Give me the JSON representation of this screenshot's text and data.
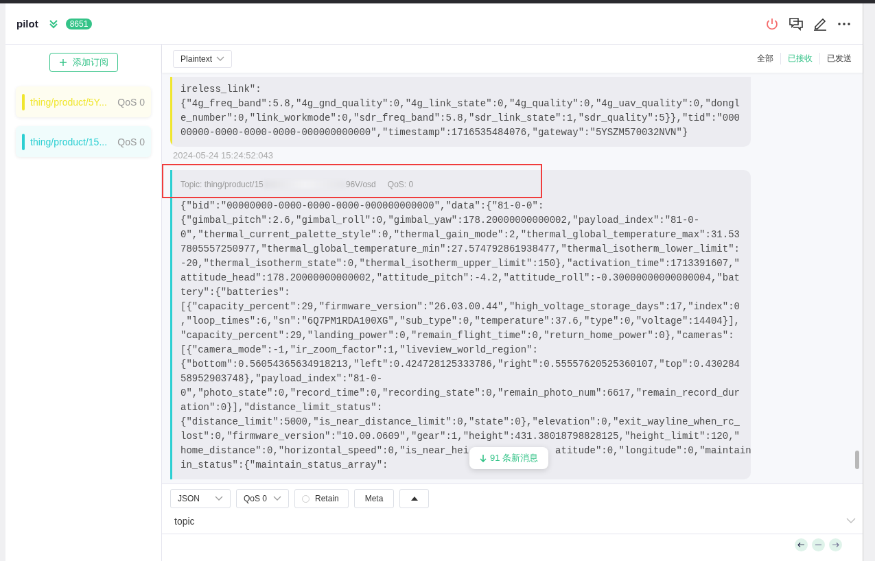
{
  "header": {
    "title": "pilot",
    "badge": "8651"
  },
  "sidebar": {
    "add_button": "添加订阅",
    "subscriptions": [
      {
        "topic": "thing/product/5Y...",
        "qos": "QoS 0",
        "color": "#f0e62e"
      },
      {
        "topic": "thing/product/15...",
        "qos": "QoS 0",
        "color": "#2ccfd2"
      }
    ]
  },
  "toolbar": {
    "format": "Plaintext",
    "filters": [
      {
        "label": "全部",
        "selected": false
      },
      {
        "label": "已接收",
        "selected": true
      },
      {
        "label": "已发送",
        "selected": false
      }
    ]
  },
  "messages": [
    {
      "color": "#f0e62e",
      "lines": [
        "ireless_link\":",
        "{\"4g_freq_band\":5.8,\"4g_gnd_quality\":0,\"4g_link_state\":0,\"4g_quality\":0,\"4g_uav_quality\":0,\"dongl",
        "e_number\":0,\"link_workmode\":0,\"sdr_freq_band\":5.8,\"sdr_link_state\":1,\"sdr_quality\":5}},\"tid\":\"000",
        "00000-0000-0000-0000-000000000000\",\"timestamp\":1716535484076,\"gateway\":\"5YSZM570032NVN\"}"
      ],
      "time": "2024-05-24 15:24:52:043"
    },
    {
      "color": "#2ccfd2",
      "topic_start": "Topic: thing/product/15",
      "topic_end": "96V/osd",
      "qos": "QoS: 0",
      "lines": [
        "{\"bid\":\"00000000-0000-0000-0000-000000000000\",\"data\":{\"81-0-0\":",
        "{\"gimbal_pitch\":2.6,\"gimbal_roll\":0,\"gimbal_yaw\":178.20000000000002,\"payload_index\":\"81-0-",
        "0\",\"thermal_current_palette_style\":0,\"thermal_gain_mode\":2,\"thermal_global_temperature_max\":31.53",
        "7805557250977,\"thermal_global_temperature_min\":27.574792861938477,\"thermal_isotherm_lower_limit\":",
        "-20,\"thermal_isotherm_state\":0,\"thermal_isotherm_upper_limit\":150},\"activation_time\":1713391607,\"",
        "attitude_head\":178.20000000000002,\"attitude_pitch\":-4.2,\"attitude_roll\":-0.30000000000000004,\"bat",
        "tery\":{\"batteries\":",
        "[{\"capacity_percent\":29,\"firmware_version\":\"26.03.00.44\",\"high_voltage_storage_days\":17,\"index\":0",
        ",\"loop_times\":6,\"sn\":\"6Q7PM1RDA100XG\",\"sub_type\":0,\"temperature\":37.6,\"type\":0,\"voltage\":14404}],",
        "\"capacity_percent\":29,\"landing_power\":0,\"remain_flight_time\":0,\"return_home_power\":0},\"cameras\":",
        "[{\"camera_mode\":-1,\"ir_zoom_factor\":1,\"liveview_world_region\":",
        "{\"bottom\":0.56054365634918213,\"left\":0.424728125333786,\"right\":0.55557620525360107,\"top\":0.430284",
        "58952903748},\"payload_index\":\"81-0-",
        "0\",\"photo_state\":0,\"record_time\":0,\"recording_state\":0,\"remain_photo_num\":6617,\"remain_record_dur",
        "ation\":0}],\"distance_limit_status\":",
        "{\"distance_limit\":5000,\"is_near_distance_limit\":0,\"state\":0},\"elevation\":0,\"exit_wayline_when_rc_",
        "lost\":0,\"firmware_version\":\"10.00.0609\",\"gear\":1,\"height\":431.38018798828125,\"height_limit\":120,\"",
        [
          "home_distance\":0,\"horizontal_speed\":0,\"is_near_hei",
          "atitude\":0,\"longitude\":0,\"maintain"
        ],
        "in_status\":{\"maintain_status_array\":"
      ]
    }
  ],
  "new_messages": "91 条新消息",
  "compose": {
    "format": "JSON",
    "qos": "QoS 0",
    "retain": {
      "label": "Retain",
      "checked": false
    },
    "meta": "Meta",
    "topic": {
      "placeholder": "topic"
    }
  }
}
